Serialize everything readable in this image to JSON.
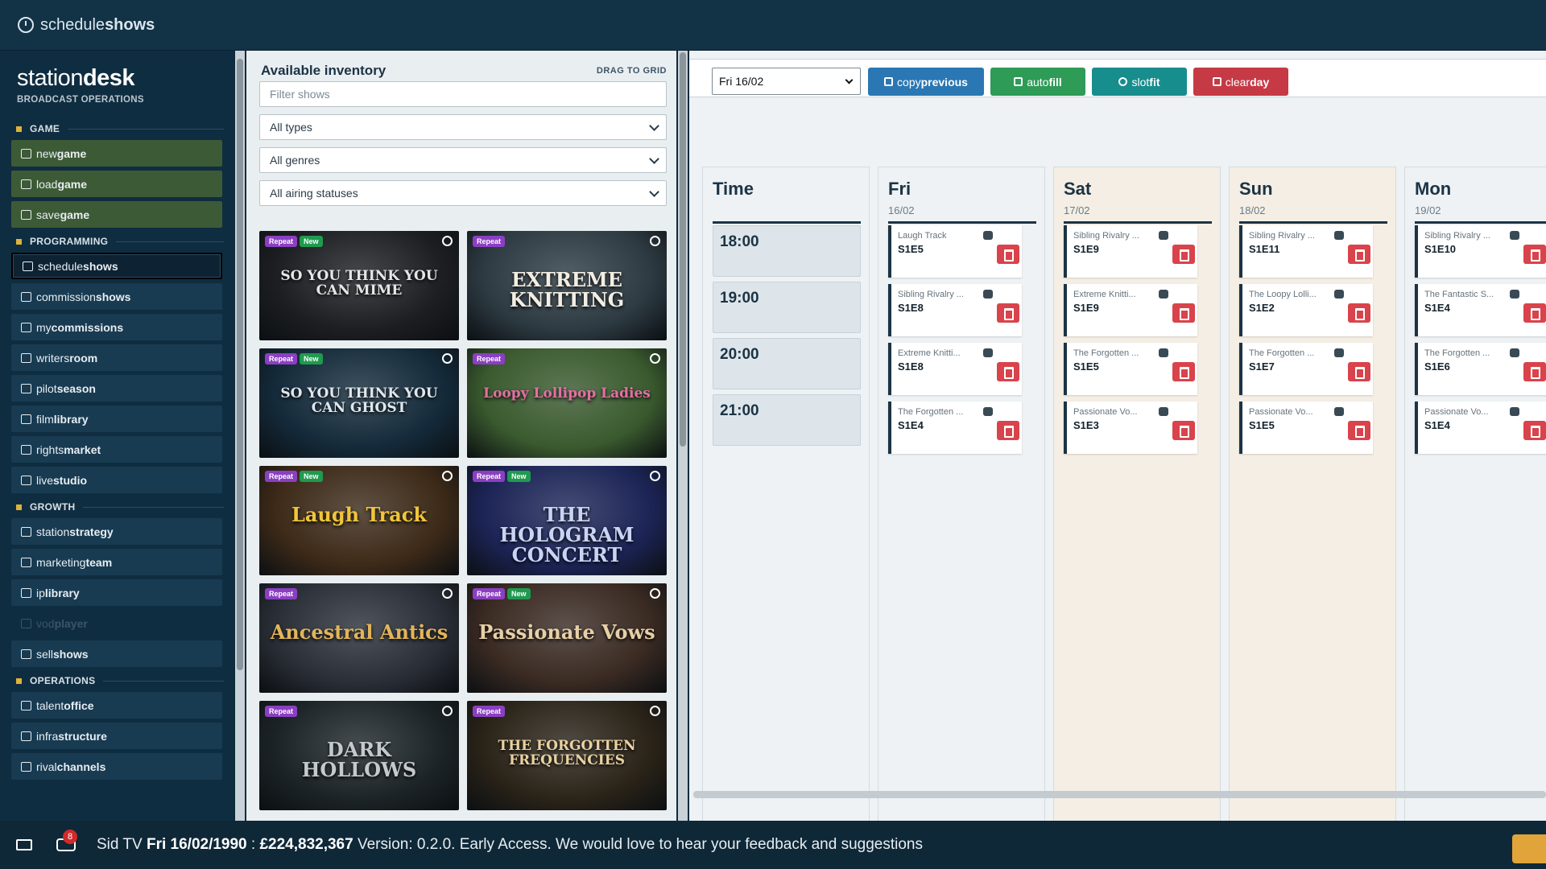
{
  "topbar": {
    "title_prefix": "schedule",
    "title_bold": "shows"
  },
  "brand": {
    "name_prefix": "station",
    "name_bold": "desk",
    "subtitle": "BROADCAST OPERATIONS"
  },
  "sidebar": {
    "sections": [
      {
        "label": "GAME",
        "items": [
          {
            "pre": "new",
            "bold": "game",
            "icon": "file-icon"
          },
          {
            "pre": "load",
            "bold": "game",
            "icon": "folder-icon"
          },
          {
            "pre": "save",
            "bold": "game",
            "icon": "save-icon"
          }
        ]
      },
      {
        "label": "PROGRAMMING",
        "items": [
          {
            "pre": "schedule",
            "bold": "shows",
            "icon": "clock-icon"
          },
          {
            "pre": "commission",
            "bold": "shows",
            "icon": "commission-icon"
          },
          {
            "pre": "my",
            "bold": "commissions",
            "icon": "monitor-icon"
          },
          {
            "pre": "writers",
            "bold": "room",
            "icon": "pen-icon"
          },
          {
            "pre": "pilot",
            "bold": "season",
            "icon": "flask-icon"
          },
          {
            "pre": "film",
            "bold": "library",
            "icon": "film-icon"
          },
          {
            "pre": "rights",
            "bold": "market",
            "icon": "trophy-icon"
          },
          {
            "pre": "live",
            "bold": "studio",
            "icon": "broadcast-icon"
          }
        ]
      },
      {
        "label": "GROWTH",
        "items": [
          {
            "pre": "station",
            "bold": "strategy",
            "icon": "chart-icon"
          },
          {
            "pre": "marketing",
            "bold": "team",
            "icon": "megaphone-icon"
          },
          {
            "pre": "ip",
            "bold": "library",
            "icon": "network-icon"
          },
          {
            "pre": "vod",
            "bold": "player",
            "icon": "play-icon"
          },
          {
            "pre": "sell",
            "bold": "shows",
            "icon": "handshake-icon"
          }
        ]
      },
      {
        "label": "OPERATIONS",
        "items": [
          {
            "pre": "talent",
            "bold": "office",
            "icon": "people-icon"
          },
          {
            "pre": "infra",
            "bold": "structure",
            "icon": "tower-icon"
          },
          {
            "pre": "rival",
            "bold": "channels",
            "icon": "chess-icon"
          }
        ]
      }
    ]
  },
  "inventory": {
    "title": "Available inventory",
    "hint": "DRAG TO GRID",
    "filter_placeholder": "Filter shows",
    "type_select": "All types",
    "genre_select": "All genres",
    "status_select": "All airing statuses",
    "tag_repeat": "Repeat",
    "tag_new": "New",
    "cards": [
      {
        "title": "SO YOU THINK YOU CAN MIME",
        "repeat": true,
        "new": true,
        "icon": "theatre-icon",
        "bg": "#1c1e22",
        "fg": "#e6e6e6"
      },
      {
        "title": "EXTREME KNITTING",
        "repeat": true,
        "new": false,
        "icon": "theatre-icon",
        "bg": "#2d3a42",
        "fg": "#f3eee2"
      },
      {
        "title": "SO YOU THINK YOU CAN GHOST",
        "repeat": true,
        "new": true,
        "icon": "theatre-icon",
        "bg": "#142a3a",
        "fg": "#dfe7ee"
      },
      {
        "title": "Loopy Lollipop Ladies",
        "repeat": true,
        "new": false,
        "icon": "smile-icon",
        "bg": "#3a5a2e",
        "fg": "#e46fa4"
      },
      {
        "title": "Laugh Track",
        "repeat": true,
        "new": true,
        "icon": "smile-icon",
        "bg": "#3d2a18",
        "fg": "#f0c53a"
      },
      {
        "title": "THE HOLOGRAM CONCERT",
        "repeat": true,
        "new": true,
        "icon": "music-icon",
        "bg": "#1c2456",
        "fg": "#c9d4f5"
      },
      {
        "title": "Ancestral Antics",
        "repeat": true,
        "new": false,
        "icon": "house-icon",
        "bg": "#2a2e36",
        "fg": "#e2b55a"
      },
      {
        "title": "Passionate Vows",
        "repeat": true,
        "new": true,
        "icon": "heart-icon",
        "bg": "#3a2a22",
        "fg": "#e7cfa7"
      },
      {
        "title": "DARK HOLLOWS",
        "repeat": true,
        "new": false,
        "icon": "skull-icon",
        "bg": "#1c2326",
        "fg": "#c3c9cc"
      },
      {
        "title": "THE FORGOTTEN FREQUENCIES",
        "repeat": true,
        "new": false,
        "icon": "music-icon",
        "bg": "#2a2318",
        "fg": "#ead2a0"
      }
    ]
  },
  "toolbar": {
    "day_select": "Fri 16/02",
    "copy_pre": "copy",
    "copy_bold": "previous",
    "autofill_pre": "auto",
    "autofill_bold": "fill",
    "slotfit_pre": "slot",
    "slotfit_bold": "fit",
    "clear_pre": "clear",
    "clear_bold": "day"
  },
  "schedule": {
    "time_header": "Time",
    "times": [
      "18:00",
      "19:00",
      "20:00",
      "21:00"
    ],
    "days": [
      {
        "name": "Fri",
        "date": "16/02",
        "bg": "#eef2f4",
        "slots": [
          {
            "title": "Laugh Track",
            "ep": "S1E5"
          },
          {
            "title": "Sibling Rivalry ...",
            "ep": "S1E8"
          },
          {
            "title": "Extreme Knitti...",
            "ep": "S1E8"
          },
          {
            "title": "The Forgotten ...",
            "ep": "S1E4"
          }
        ]
      },
      {
        "name": "Sat",
        "date": "17/02",
        "bg": "#f4eee4",
        "slots": [
          {
            "title": "Sibling Rivalry ...",
            "ep": "S1E9"
          },
          {
            "title": "Extreme Knitti...",
            "ep": "S1E9"
          },
          {
            "title": "The Forgotten ...",
            "ep": "S1E5"
          },
          {
            "title": "Passionate Vo...",
            "ep": "S1E3"
          }
        ]
      },
      {
        "name": "Sun",
        "date": "18/02",
        "bg": "#f4eee4",
        "slots": [
          {
            "title": "Sibling Rivalry ...",
            "ep": "S1E11"
          },
          {
            "title": "The Loopy Lolli...",
            "ep": "S1E2"
          },
          {
            "title": "The Forgotten ...",
            "ep": "S1E7"
          },
          {
            "title": "Passionate Vo...",
            "ep": "S1E5"
          }
        ]
      },
      {
        "name": "Mon",
        "date": "19/02",
        "bg": "#eef2f4",
        "slots": [
          {
            "title": "Sibling Rivalry ...",
            "ep": "S1E10"
          },
          {
            "title": "The Fantastic S...",
            "ep": "S1E4"
          },
          {
            "title": "The Forgotten ...",
            "ep": "S1E6"
          },
          {
            "title": "Passionate Vo...",
            "ep": "S1E4"
          }
        ]
      }
    ]
  },
  "footer": {
    "badge": "8",
    "station": "Sid TV",
    "date": "Fri 16/02/1990",
    "sep": ":",
    "money": "£224,832,367",
    "message": "Version: 0.2.0. Early Access. We would love to hear your feedback and suggestions"
  }
}
